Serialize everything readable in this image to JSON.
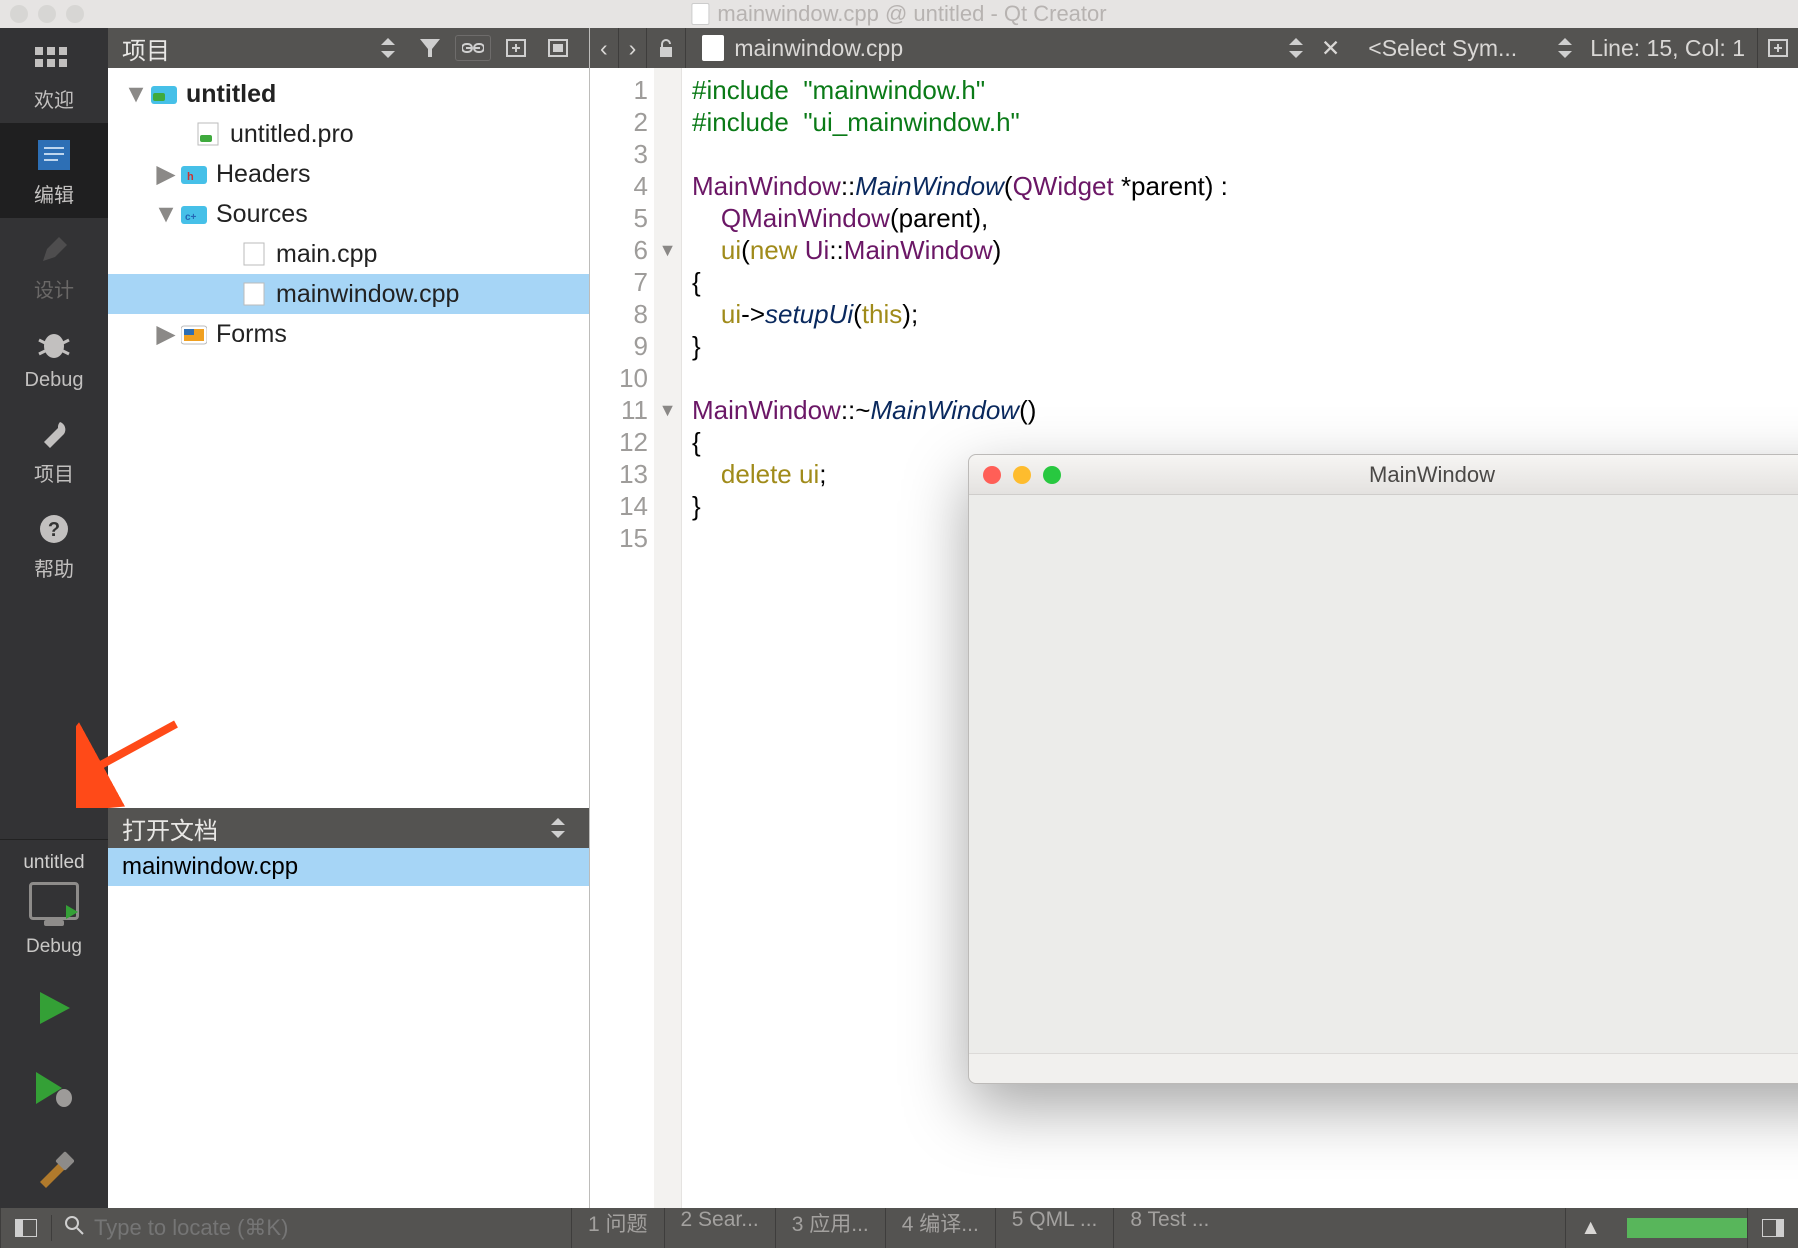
{
  "window": {
    "title": "mainwindow.cpp @ untitled - Qt Creator"
  },
  "modebar": {
    "welcome": "欢迎",
    "edit": "编辑",
    "design": "设计",
    "debug": "Debug",
    "project": "项目",
    "help": "帮助",
    "kit_project": "untitled",
    "kit_config": "Debug"
  },
  "project_panel": {
    "title": "项目",
    "tree": {
      "root": "untitled",
      "pro_file": "untitled.pro",
      "headers": "Headers",
      "sources": "Sources",
      "main_cpp": "main.cpp",
      "mainwindow_cpp": "mainwindow.cpp",
      "forms": "Forms"
    }
  },
  "open_docs": {
    "title": "打开文档",
    "items": [
      "mainwindow.cpp"
    ]
  },
  "editor_toolbar": {
    "filename": "mainwindow.cpp",
    "symbol_placeholder": "<Select Sym...",
    "linecol": "Line: 15, Col: 1"
  },
  "code": {
    "lines": [
      {
        "n": 1,
        "html": "<span class='tok-inc'>#include</span>  <span class='tok-str'>\"mainwindow.h\"</span>"
      },
      {
        "n": 2,
        "html": "<span class='tok-inc'>#include</span>  <span class='tok-str'>\"ui_mainwindow.h\"</span>"
      },
      {
        "n": 3,
        "html": ""
      },
      {
        "n": 4,
        "html": "<span class='tok-type'>MainWindow</span>::<span class='tok-func'>MainWindow</span>(<span class='tok-type'>QWidget</span> *parent) :"
      },
      {
        "n": 5,
        "html": "    <span class='tok-type'>QMainWindow</span>(parent),"
      },
      {
        "n": 6,
        "fold": true,
        "html": "    <span class='tok-kw'>ui</span>(<span class='tok-kw'>new</span> <span class='tok-type'>Ui</span>::<span class='tok-type'>MainWindow</span>)"
      },
      {
        "n": 7,
        "html": "{"
      },
      {
        "n": 8,
        "html": "    <span class='tok-kw'>ui</span>-&gt;<span class='tok-func'>setupUi</span>(<span class='tok-kw'>this</span>);"
      },
      {
        "n": 9,
        "html": "}"
      },
      {
        "n": 10,
        "html": ""
      },
      {
        "n": 11,
        "fold": true,
        "html": "<span class='tok-type'>MainWindow</span>::~<span class='tok-func'>MainWindow</span>()"
      },
      {
        "n": 12,
        "html": "{"
      },
      {
        "n": 13,
        "html": "    <span class='tok-kw'>delete</span> <span class='tok-kw'>ui</span>;"
      },
      {
        "n": 14,
        "html": "}"
      },
      {
        "n": 15,
        "html": ""
      }
    ]
  },
  "overlay": {
    "title": "MainWindow"
  },
  "bottom": {
    "locator_placeholder": "Type to locate (⌘K)",
    "items": [
      "1 问题",
      "2 Sear...",
      "3 应用...",
      "4 编译...",
      "5 QML ...",
      "8 Test ..."
    ]
  }
}
